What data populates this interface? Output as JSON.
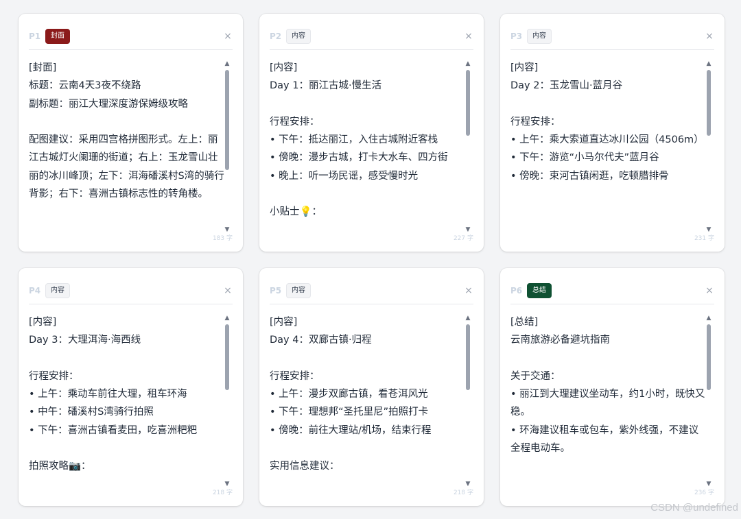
{
  "cards": [
    {
      "page": "P1",
      "badge": "封面",
      "badge_type": "cover",
      "text": "[封面]\n标题：云南4天3夜不绕路\n副标题：丽江大理深度游保姆级攻略\n\n配图建议：采用四宫格拼图形式。左上：丽江古城灯火阑珊的街道；右上：玉龙雪山壮丽的冰川峰顶；左下：洱海磻溪村S湾的骑行背影；右下：喜洲古镇标志性的转角楼。",
      "count": "183 字"
    },
    {
      "page": "P2",
      "badge": "内容",
      "badge_type": "content",
      "text": "[内容]\nDay 1：丽江古城·慢生活\n\n行程安排：\n• 下午：抵达丽江，入住古城附近客栈\n• 傍晚：漫步古城，打卡大水车、四方街\n• 晚上：听一场民谣，感受慢时光\n\n小贴士💡：",
      "count": "227 字"
    },
    {
      "page": "P3",
      "badge": "内容",
      "badge_type": "content",
      "text": "[内容]\nDay 2：玉龙雪山·蓝月谷\n\n行程安排：\n• 上午：乘大索道直达冰川公园（4506m）\n• 下午：游览“小马尔代夫”蓝月谷\n• 傍晚：束河古镇闲逛，吃顿腊排骨",
      "count": "231 字"
    },
    {
      "page": "P4",
      "badge": "内容",
      "badge_type": "content",
      "text": "[内容]\nDay 3：大理洱海·海西线\n\n行程安排：\n• 上午：乘动车前往大理，租车环海\n• 中午：磻溪村S湾骑行拍照\n• 下午：喜洲古镇看麦田，吃喜洲粑粑\n\n拍照攻略📷：",
      "count": "218 字"
    },
    {
      "page": "P5",
      "badge": "内容",
      "badge_type": "content",
      "text": "[内容]\nDay 4：双廊古镇·归程\n\n行程安排：\n• 上午：漫步双廊古镇，看苍洱风光\n• 下午：理想邦“圣托里尼”拍照打卡\n• 傍晚：前往大理站/机场，结束行程\n\n实用信息建议：",
      "count": "218 字"
    },
    {
      "page": "P6",
      "badge": "总结",
      "badge_type": "summary",
      "text": "[总结]\n云南旅游必备避坑指南\n\n关于交通：\n• 丽江到大理建议坐动车，约1小时，既快又稳。\n• 环海建议租车或包车，紫外线强，不建议全程电动车。",
      "count": "236 字"
    }
  ],
  "icons": {
    "close": "×",
    "scroll_up": "▲",
    "scroll_down": "▼"
  },
  "watermark": "CSDN @undefined",
  "colors": {
    "cover_badge": "#8b1a1a",
    "summary_badge": "#0f5132",
    "content_badge_bg": "#f3f4f6"
  }
}
